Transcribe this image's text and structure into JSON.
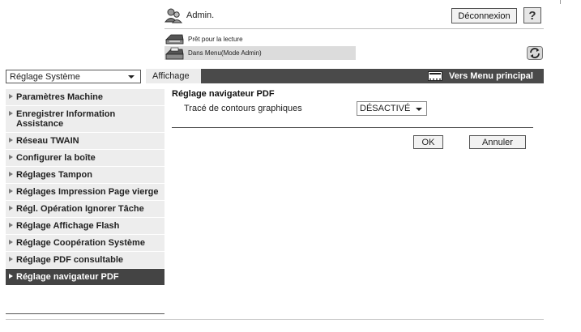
{
  "header": {
    "user_label": "Admin.",
    "logout_label": "Déconnexion",
    "help_label": "?",
    "status_ready": "Prêt pour la lecture",
    "status_mode": "Dans Menu(Mode Admin)",
    "user_icon": "user-icon",
    "printer_icon": "printer-icon",
    "refresh_icon": "refresh-icon"
  },
  "toolbar": {
    "system_select_value": "Réglage Système",
    "display_tab": "Affichage",
    "main_menu_label": "Vers Menu principal",
    "main_menu_icon": "menu-icon"
  },
  "sidebar": {
    "items": [
      {
        "label": "Paramètres Machine",
        "active": false
      },
      {
        "label": "Enregistrer Information Assistance",
        "active": false
      },
      {
        "label": "Réseau TWAIN",
        "active": false
      },
      {
        "label": "Configurer la boîte",
        "active": false
      },
      {
        "label": "Réglages Tampon",
        "active": false
      },
      {
        "label": "Réglages Impression Page vierge",
        "active": false
      },
      {
        "label": "Régl. Opération Ignorer Tâche",
        "active": false
      },
      {
        "label": "Réglage Affichage Flash",
        "active": false
      },
      {
        "label": "Réglage Coopération Système",
        "active": false
      },
      {
        "label": "Réglage PDF consultable",
        "active": false
      },
      {
        "label": "Réglage navigateur PDF",
        "active": true
      }
    ]
  },
  "main": {
    "title": "Réglage navigateur PDF",
    "setting_label": "Tracé de contours graphiques",
    "setting_value": "DÉSACTIVÉ",
    "ok_label": "OK",
    "cancel_label": "Annuler"
  },
  "colors": {
    "toolbar_bg": "#4a4a4a",
    "sidebar_item_bg": "#ededed",
    "sidebar_active_bg": "#444444",
    "status_bar_bg": "#dcdcdc"
  }
}
